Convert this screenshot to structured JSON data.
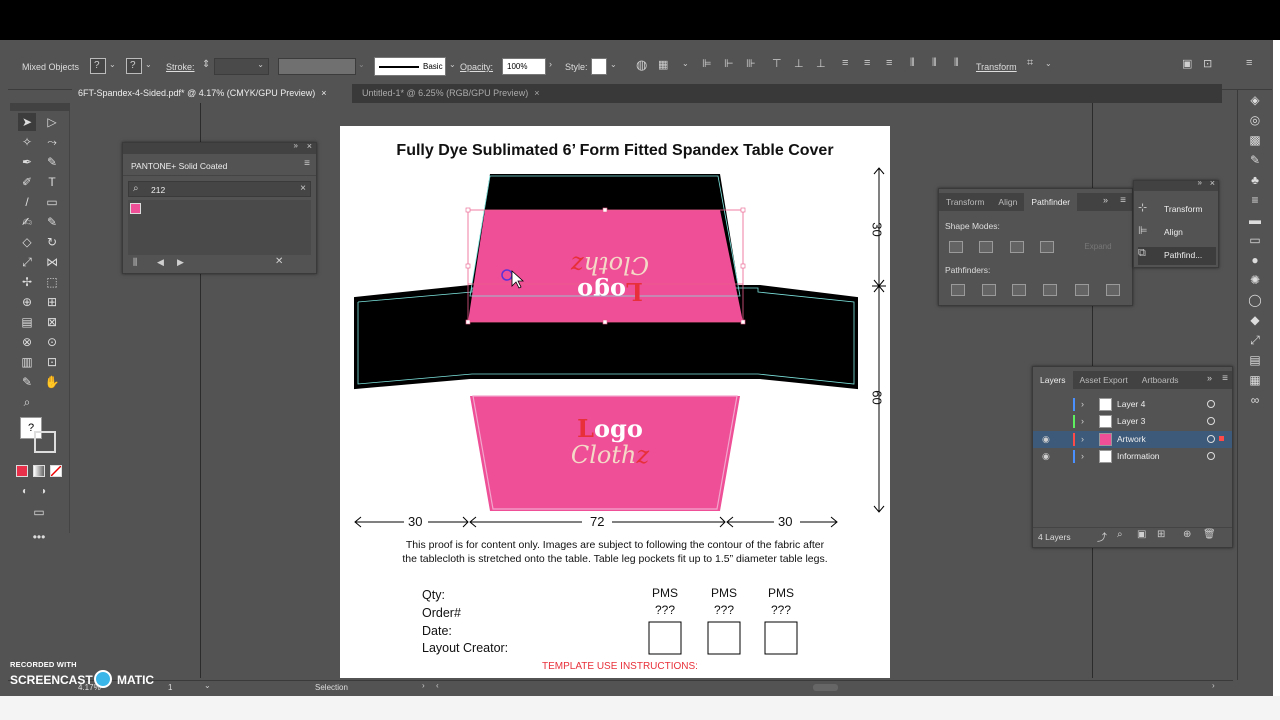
{
  "colors": {
    "pink": "#ee4f97",
    "logo_red": "#e8303a",
    "cream": "#f4d9c7",
    "artwork_black": "#000000",
    "teal_outline": "#7ee6e0",
    "layer_blue": "#4a90ff",
    "layer_green": "#5ff05f",
    "layer_red": "#ff4a4a",
    "selection_blue": "#3d5a7a"
  },
  "control_bar": {
    "selection_type": "Mixed Objects",
    "stroke_label": "Stroke:",
    "brush_label": "Basic",
    "opacity_label": "Opacity:",
    "opacity_value": "100%",
    "style_label": "Style:",
    "transform_link": "Transform"
  },
  "tabs": [
    {
      "label": "6FT-Spandex-4-Sided.pdf* @ 4.17% (CMYK/GPU Preview)",
      "close": "×"
    },
    {
      "label": "Untitled-1* @ 6.25% (RGB/GPU Preview)",
      "close": "×"
    }
  ],
  "swatch_panel": {
    "title": "PANTONE+ Solid Coated",
    "search_value": "212",
    "clear": "×"
  },
  "artboard": {
    "title": "Fully Dye Sublimated 6’ Form Fitted Spandex Table Cover",
    "dim_top_right": "30",
    "dim_right": "60",
    "dim_left": "30",
    "dim_center": "72",
    "dim_right_bottom": "30",
    "logo_word": "Logo",
    "logo_first": "L",
    "logo_rest": "ogo",
    "cloth_word": "Clothz",
    "cloth_first": "Cloth",
    "cloth_last": "z",
    "note_line1": "This proof is for content only. Images are subject to following the contour of the fabric after",
    "note_line2": "the tablecloth is stretched onto the table. Table leg pockets fit up to 1.5” diameter table legs.",
    "qty_label": "Qty:",
    "order_label": "Order#",
    "date_label": "Date:",
    "creator_label": "Layout Creator:",
    "pms": [
      {
        "label": "PMS",
        "value": "???"
      },
      {
        "label": "PMS",
        "value": "???"
      },
      {
        "label": "PMS",
        "value": "???"
      }
    ],
    "instructions": "TEMPLATE USE INSTRUCTIONS:"
  },
  "pathfinder_panel": {
    "tabs": [
      "Transform",
      "Align",
      "Pathfinder"
    ],
    "active_tab": "Pathfinder",
    "shape_modes_label": "Shape Modes:",
    "expand_label": "Expand",
    "pathfinders_label": "Pathfinders:"
  },
  "mini_panel": {
    "items": [
      "Transform",
      "Align",
      "Pathfind..."
    ]
  },
  "layers_panel": {
    "tabs": [
      "Layers",
      "Asset Export",
      "Artboards"
    ],
    "active_tab": "Layers",
    "layers": [
      {
        "name": "Layer 4",
        "visible": false,
        "color": "#4a90ff",
        "selected": false
      },
      {
        "name": "Layer 3",
        "visible": false,
        "color": "#5ff05f",
        "selected": false
      },
      {
        "name": "Artwork",
        "visible": true,
        "color": "#ff4a4a",
        "selected": true
      },
      {
        "name": "Information",
        "visible": true,
        "color": "#4a90ff",
        "selected": false
      }
    ],
    "count_label": "4 Layers"
  },
  "status_bar": {
    "zoom": "4.17%",
    "artboard_num": "1",
    "tool_name": "Selection"
  },
  "watermark": {
    "line1": "RECORDED WITH",
    "brand_left": "SCREENCAST",
    "brand_right": "MATIC"
  }
}
